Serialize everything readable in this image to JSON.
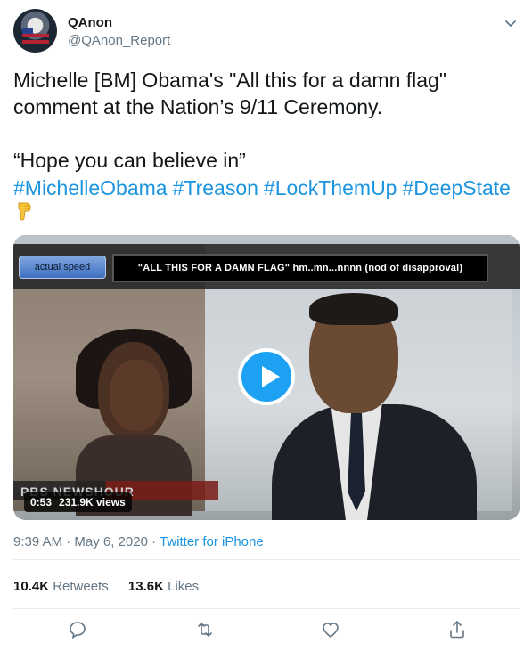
{
  "author": {
    "name": "QAnon",
    "handle": "@QAnon_Report"
  },
  "tweet": {
    "text": "Michelle [BM] Obama's \"All this for a damn flag\" comment at the Nation’s 9/11 Ceremony.\n\n“Hope you can believe in”",
    "hashtags": [
      "#MichelleObama",
      "#Treason",
      "#LockThemUp",
      "#DeepState"
    ],
    "emoji": "backhand-index-pointing-down"
  },
  "video": {
    "speed_label": "actual speed",
    "caption": "\"ALL THIS FOR A DAMN FLAG\" hm..mn...nnnn (nod of disapproval)",
    "watermark": "PBS NEWSHOUR",
    "duration": "0:53",
    "views": "231.9K views"
  },
  "meta": {
    "time": "9:39 AM · May 6, 2020 · ",
    "source": "Twitter for iPhone"
  },
  "stats": {
    "retweets_count": "10.4K",
    "retweets_label": "Retweets",
    "likes_count": "13.6K",
    "likes_label": "Likes"
  },
  "colors": {
    "link": "#1b95e0",
    "secondary_text": "#657786",
    "play_button": "#1da1f2"
  }
}
